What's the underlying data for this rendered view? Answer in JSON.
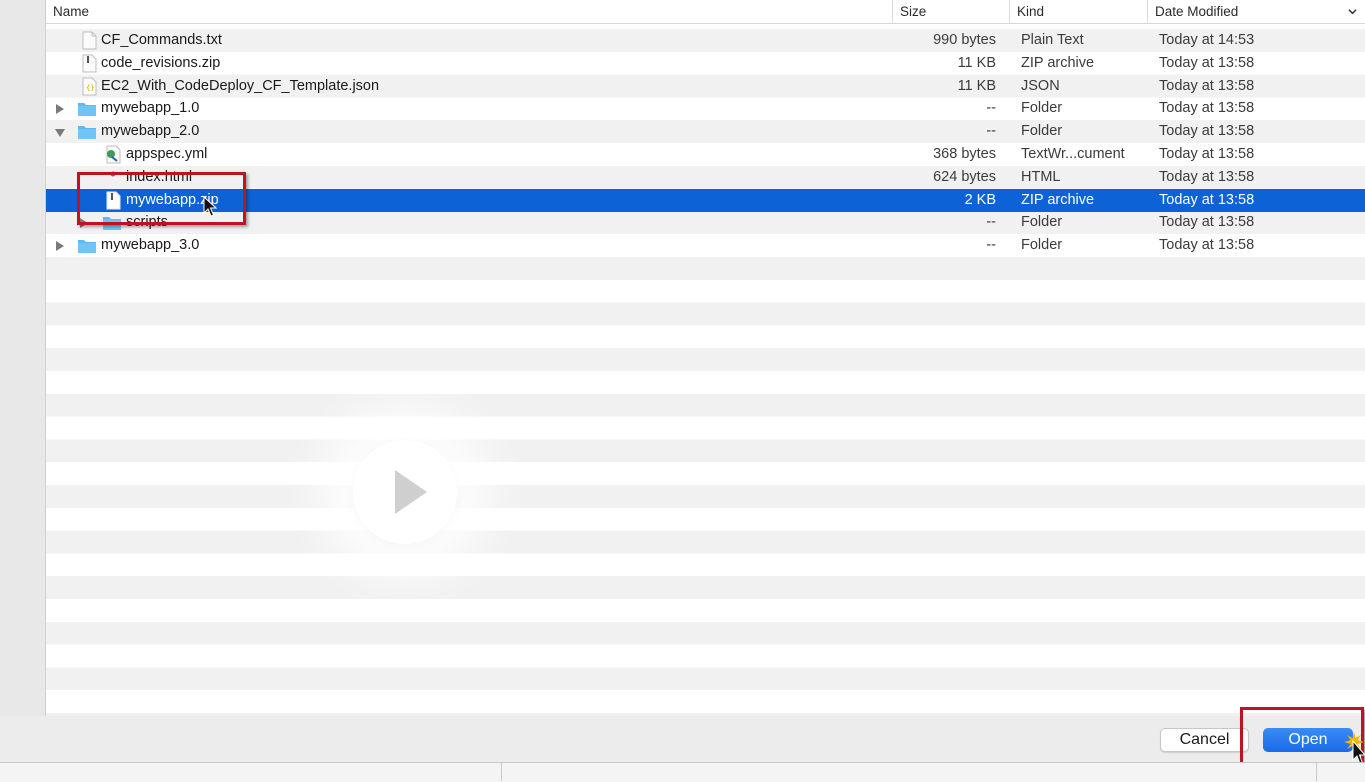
{
  "columns": {
    "name": "Name",
    "size": "Size",
    "kind": "Kind",
    "date": "Date Modified"
  },
  "rows": [
    {
      "name": "CF_Commands.txt",
      "size": "990 bytes",
      "kind": "Plain Text",
      "date": "Today at 14:53",
      "icon": "text-file-icon",
      "level": 0
    },
    {
      "name": "code_revisions.zip",
      "size": "11 KB",
      "kind": "ZIP archive",
      "date": "Today at 13:58",
      "icon": "zip-file-icon",
      "level": 0
    },
    {
      "name": "EC2_With_CodeDeploy_CF_Template.json",
      "size": "11 KB",
      "kind": "JSON",
      "date": "Today at 13:58",
      "icon": "json-file-icon",
      "level": 0
    },
    {
      "name": "mywebapp_1.0",
      "size": "--",
      "kind": "Folder",
      "date": "Today at 13:58",
      "icon": "folder-icon",
      "level": 0,
      "disclosure": "collapsed"
    },
    {
      "name": "mywebapp_2.0",
      "size": "--",
      "kind": "Folder",
      "date": "Today at 13:58",
      "icon": "folder-icon",
      "level": 0,
      "disclosure": "expanded"
    },
    {
      "name": "appspec.yml",
      "size": "368 bytes",
      "kind": "TextWr...cument",
      "date": "Today at 13:58",
      "icon": "yml-file-icon",
      "level": 1
    },
    {
      "name": "index.html",
      "size": "624 bytes",
      "kind": "HTML",
      "date": "Today at 13:58",
      "icon": "html-file-icon",
      "level": 1
    },
    {
      "name": "mywebapp.zip",
      "size": "2 KB",
      "kind": "ZIP archive",
      "date": "Today at 13:58",
      "icon": "zip-file-icon",
      "level": 1,
      "selected": true
    },
    {
      "name": "scripts",
      "size": "--",
      "kind": "Folder",
      "date": "Today at 13:58",
      "icon": "folder-icon",
      "level": 1,
      "disclosure": "collapsed"
    },
    {
      "name": "mywebapp_3.0",
      "size": "--",
      "kind": "Folder",
      "date": "Today at 13:58",
      "icon": "folder-icon",
      "level": 0,
      "disclosure": "collapsed"
    }
  ],
  "buttons": {
    "cancel": "Cancel",
    "open": "Open"
  },
  "colors": {
    "selection": "#0d63d6",
    "highlight": "#c1121f",
    "folder": "#5fb8f0"
  }
}
